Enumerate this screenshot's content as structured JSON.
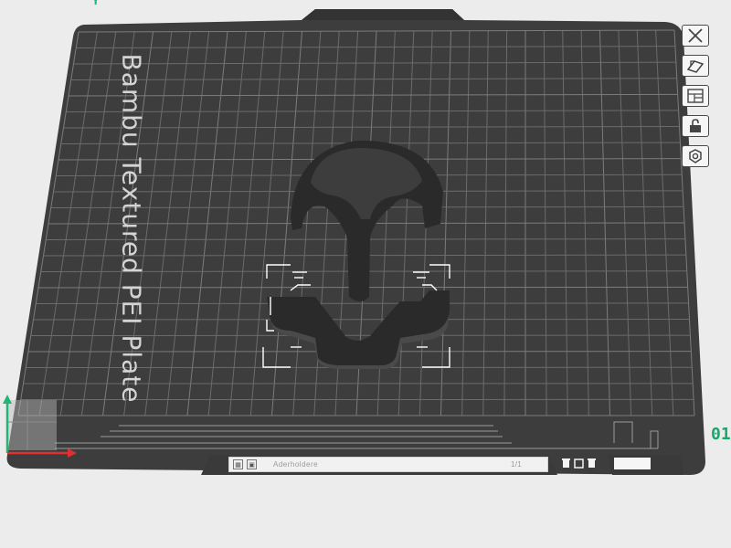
{
  "plate": {
    "label": "Bambu Textured PEI Plate"
  },
  "toolbar": {
    "items": [
      {
        "name": "close",
        "icon": "close-icon"
      },
      {
        "name": "auto-orient",
        "icon": "orient-icon"
      },
      {
        "name": "arrange",
        "icon": "arrange-icon"
      },
      {
        "name": "lock",
        "icon": "lock-icon"
      },
      {
        "name": "plate-settings",
        "icon": "gear-icon"
      }
    ]
  },
  "bottom_bar": {
    "plate_name": "Aderholdere",
    "extra": "1/1"
  },
  "edge_readout": "01",
  "corner_glyph": "Y",
  "colors": {
    "plate": "#3d3d3d",
    "grid": "#6a6a6a",
    "model": "#2b2b2b",
    "selection": "#ffffff",
    "axis_x": "#e03030",
    "axis_y": "#22b573"
  }
}
